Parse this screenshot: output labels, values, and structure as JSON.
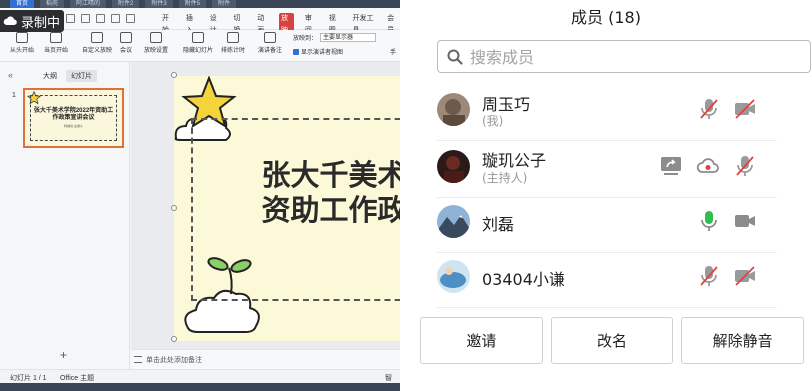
{
  "taskbar_top": {
    "tabs": [
      "首页",
      "稻壳",
      "阿江晴的",
      "附件2",
      "附件3",
      "附件5",
      "附件"
    ]
  },
  "recording": {
    "label": "录制中"
  },
  "ribbon": {
    "menu_tabs": [
      "开始",
      "插入",
      "设计",
      "切换",
      "动画",
      "放映",
      "审阅",
      "视图",
      "开发工具",
      "会员"
    ],
    "active_tab": "放映",
    "tools": [
      "从头开始",
      "当页开始",
      "自定义放映",
      "会议",
      "放映设置",
      "隐藏幻灯片",
      "排练计时",
      "演讲备注"
    ],
    "play_to_label": "放映到：",
    "play_to_value": "主要显示器",
    "presenter_view_label": "显示演讲者视图",
    "hand_label": "手"
  },
  "side_panel": {
    "tabs": [
      "大纲",
      "幻灯片"
    ],
    "active_tab": "幻灯片",
    "slide_number": "1",
    "thumb_title": "张大千美术学院2022年资助工作政策宣讲会议",
    "thumb_subtitle": "科技处 主讲人"
  },
  "slide": {
    "title_line1": "张大千美术",
    "title_line2": "资助工作政"
  },
  "notes": {
    "placeholder": "单击此处添加备注"
  },
  "status": {
    "slide_info": "幻灯片 1 / 1",
    "theme": "Office 主题",
    "extra": "智"
  },
  "members_panel": {
    "title": "成员 (18)",
    "search_placeholder": "搜索成员",
    "members": [
      {
        "name": "周玉巧",
        "tag": "(我)",
        "icons": [
          "mic-muted-icon",
          "camera-off-icon"
        ]
      },
      {
        "name": "璇玑公子",
        "tag": "(主持人)",
        "icons": [
          "screen-share-icon",
          "cloud-record-icon",
          "mic-muted-icon"
        ]
      },
      {
        "name": "刘磊",
        "tag": "",
        "icons": [
          "mic-active-icon",
          "camera-icon"
        ]
      },
      {
        "name": "03404小谦",
        "tag": "",
        "icons": [
          "mic-muted-icon",
          "camera-off-icon"
        ]
      }
    ],
    "buttons": {
      "invite": "邀请",
      "rename": "改名",
      "unmute": "解除静音"
    }
  },
  "colors": {
    "muted_red": "#e0433b",
    "mic_green": "#2fbf4f",
    "icon_gray": "#8c8c8c",
    "active_tab_red": "#d9433f"
  }
}
